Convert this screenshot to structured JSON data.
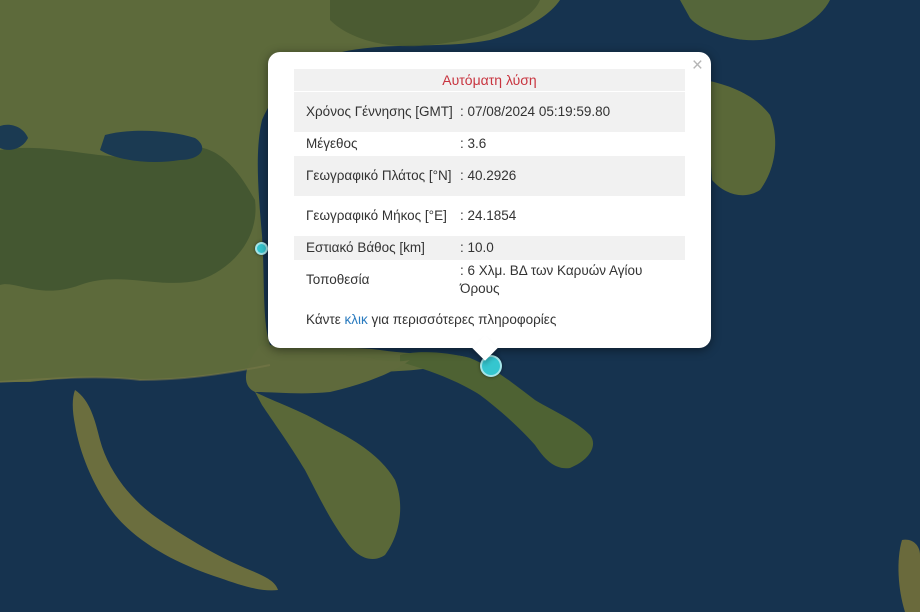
{
  "popup": {
    "title": "Αυτόματη λύση",
    "close_symbol": "×",
    "rows": [
      {
        "label": "Χρόνος Γέννησης [GMT]",
        "value": ": 07/08/2024 05:19:59.80"
      },
      {
        "label": "Μέγεθος",
        "value": ": 3.6"
      },
      {
        "label": "Γεωγραφικό Πλάτος [°N]",
        "value": ": 40.2926"
      },
      {
        "label": "Γεωγραφικό Μήκος [°E]",
        "value": ": 24.1854"
      },
      {
        "label": "Εστιακό Βάθος [km]",
        "value": ": 10.0"
      },
      {
        "label": "Τοποθεσία",
        "value": ": 6 Χλμ. ΒΔ των Καρυών Αγίου Όρους"
      }
    ],
    "more_prefix": "Κάντε ",
    "more_link": "κλικ",
    "more_suffix": " για περισσότερες πληροφορίες"
  },
  "colors": {
    "sea": "#16334f",
    "land": "#5f6a3c",
    "marker": "#35c6cf",
    "title_text": "#c8343f",
    "link": "#2a7bbf"
  }
}
